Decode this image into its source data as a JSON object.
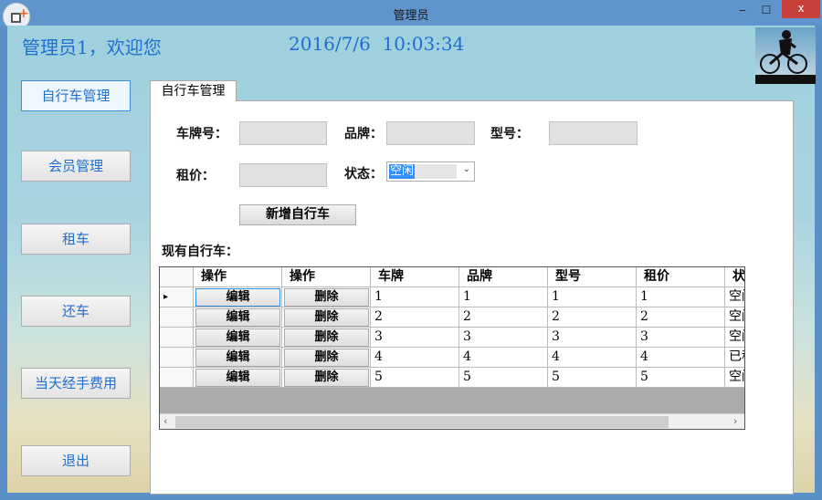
{
  "window": {
    "title": "管理员",
    "minimize": "‒",
    "maximize": "☐",
    "close": "x"
  },
  "header": {
    "welcome": "管理员1，欢迎您",
    "datetime": "2016/7/6  10:03:34"
  },
  "sidebar": {
    "items": [
      {
        "label": "自行车管理"
      },
      {
        "label": "会员管理"
      },
      {
        "label": "租车"
      },
      {
        "label": "还车"
      },
      {
        "label": "当天经手费用"
      },
      {
        "label": "退出"
      }
    ]
  },
  "tab": {
    "label": "自行车管理"
  },
  "form": {
    "plate_label": "车牌号：",
    "plate_value": "",
    "brand_label": "品牌：",
    "brand_value": "",
    "model_label": "型号：",
    "model_value": "",
    "price_label": "租价：",
    "price_value": "",
    "status_label": "状态：",
    "status_value": "空闲",
    "add_button": "新增自行车",
    "list_label": "现有自行车："
  },
  "grid": {
    "headers": [
      "操作",
      "操作",
      "车牌",
      "品牌",
      "型号",
      "租价",
      "状态"
    ],
    "edit_label": "编辑",
    "delete_label": "删除",
    "rows": [
      [
        "1",
        "1",
        "1",
        "1",
        "空闲"
      ],
      [
        "2",
        "2",
        "2",
        "2",
        "空闲"
      ],
      [
        "3",
        "3",
        "3",
        "3",
        "空闲"
      ],
      [
        "4",
        "4",
        "4",
        "4",
        "已租"
      ],
      [
        "5",
        "5",
        "5",
        "5",
        "空闲"
      ]
    ]
  }
}
